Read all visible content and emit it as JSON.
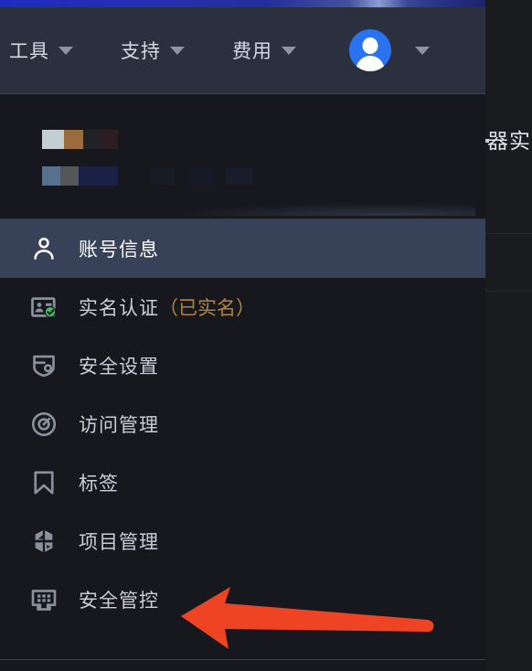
{
  "navbar": {
    "items": [
      {
        "label": "工具",
        "icon": "chevron-down-icon"
      },
      {
        "label": "支持",
        "icon": "chevron-down-icon"
      },
      {
        "label": "费用",
        "icon": "chevron-down-icon"
      }
    ],
    "account": {
      "avatar_icon": "user-avatar-icon",
      "caret_icon": "chevron-down-icon",
      "avatar_color": "#2a72f0"
    }
  },
  "panel": {
    "identity_redacted": true,
    "menu": [
      {
        "label": "账号信息",
        "suffix": "",
        "icon": "person-icon",
        "active": true
      },
      {
        "label": "实名认证",
        "suffix": "（已实名）",
        "icon": "id-card-verified-icon",
        "active": false
      },
      {
        "label": "安全设置",
        "suffix": "",
        "icon": "shield-settings-icon",
        "active": false
      },
      {
        "label": "访问管理",
        "suffix": "",
        "icon": "access-control-icon",
        "active": false
      },
      {
        "label": "标签",
        "suffix": "",
        "icon": "bookmark-icon",
        "active": false
      },
      {
        "label": "项目管理",
        "suffix": "",
        "icon": "hexagon-segments-icon",
        "active": false
      },
      {
        "label": "安全管控",
        "suffix": "",
        "icon": "keypad-monitor-icon",
        "active": false
      }
    ]
  },
  "content": {
    "clipped_heading": "器实"
  },
  "annotation": {
    "arrow_icon": "left-arrow-annotation",
    "arrow_color": "#ef4423",
    "points_at": "安全管控"
  },
  "colors": {
    "panel_bg": "#16181e",
    "navbar_bg": "#2a303d",
    "active_row": "#374157",
    "text_primary": "#c9ced8",
    "text_accent": "#b5843c",
    "verified_badge": "#3cc35d"
  }
}
